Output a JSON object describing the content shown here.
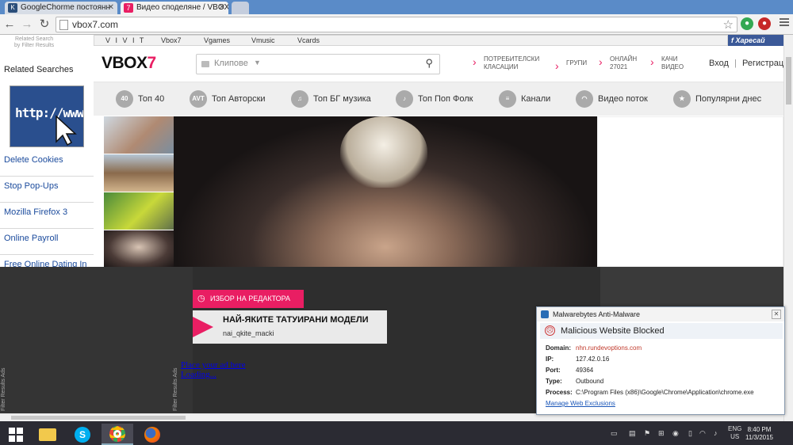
{
  "browser": {
    "tabs": [
      {
        "title": "GoogleChorme постоянн",
        "fav": "K"
      },
      {
        "title": "Видео споделяне / VBOX",
        "fav": "7"
      }
    ],
    "url": "vbox7.com"
  },
  "sidebar": {
    "tiny_line1": "Related Search",
    "tiny_line2": "by Filter Results",
    "heading": "Related Searches",
    "image_text": "http://www",
    "links": [
      "Delete Cookies",
      "Stop Pop-Ups",
      "Mozilla Firefox 3",
      "Online Payroll",
      "Free Online Dating In"
    ],
    "vertical_label": "Filter Results Ads"
  },
  "site": {
    "topnav": [
      "V I V I T",
      "Vbox7",
      "Vgames",
      "Vmusic",
      "Vcards"
    ],
    "fb_label": "Харесай",
    "logo_main": "VBOX",
    "logo_accent": "7",
    "search_placeholder": "Клипове",
    "header_links": [
      {
        "l1": "ПОТРЕБИТЕЛСКИ",
        "l2": "КЛАСАЦИИ"
      },
      {
        "l1": "ГРУПИ",
        "l2": ""
      },
      {
        "l1": "ОНЛАЙН",
        "l2": "27021"
      },
      {
        "l1": "КАЧИ",
        "l2": "ВИДЕО"
      }
    ],
    "login": "Вход",
    "register": "Регистрация",
    "categories": [
      {
        "icon": "40",
        "label": "Топ 40"
      },
      {
        "icon": "AVT",
        "label": "Топ Авторски"
      },
      {
        "icon": "",
        "label": "Топ БГ музика"
      },
      {
        "icon": "",
        "label": "Топ Поп Фолк"
      },
      {
        "icon": "",
        "label": "Канали"
      },
      {
        "icon": "",
        "label": "Видео поток"
      },
      {
        "icon": "",
        "label": "Популярни днес"
      }
    ],
    "editor_label": "ИЗБОР НА РЕДАКТОРА",
    "featured_title": "НАЙ-ЯКИТЕ ТАТУИРАНИ МОДЕЛИ",
    "featured_sub": "nai_qkite_macki",
    "ad_link1": "Place your ad here",
    "ad_link2": "Loading..."
  },
  "malwarebytes": {
    "app": "Malwarebytes Anti-Malware",
    "title": "Malicious Website Blocked",
    "rows": [
      {
        "k": "Domain:",
        "v": "nhn.rundevoptions.com"
      },
      {
        "k": "IP:",
        "v": "127.42.0.16"
      },
      {
        "k": "Port:",
        "v": "49364"
      },
      {
        "k": "Type:",
        "v": "Outbound"
      },
      {
        "k": "Process:",
        "v": "C:\\Program Files (x86)\\Google\\Chrome\\Application\\chrome.exe"
      }
    ],
    "link": "Manage Web Exclusions"
  },
  "taskbar": {
    "lang1": "ENG",
    "lang2": "US",
    "time": "8:40 PM",
    "date": "11/3/2015"
  },
  "colors": {
    "accent": "#e91e63",
    "chrome_tabbar": "#5a8bc8",
    "facebook": "#3b5998",
    "taskbar": "#2b2b33"
  }
}
